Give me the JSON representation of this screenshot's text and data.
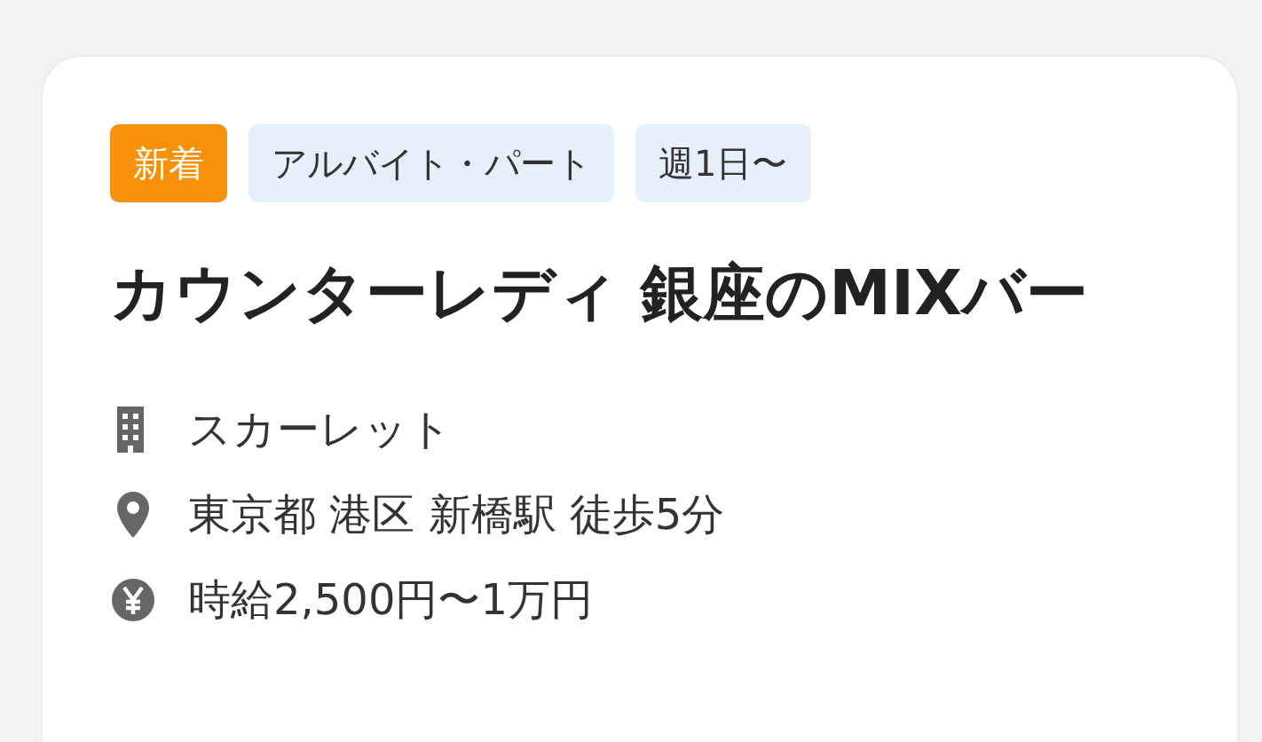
{
  "tags": [
    {
      "label": "新着",
      "kind": "new"
    },
    {
      "label": "アルバイト・パート",
      "kind": "normal"
    },
    {
      "label": "週1日〜",
      "kind": "normal"
    }
  ],
  "title": "カウンターレディ 銀座のMIXバー",
  "details": [
    {
      "kind": "company",
      "text": "スカーレット"
    },
    {
      "kind": "location",
      "text": "東京都 港区 新橋駅 徒歩5分"
    },
    {
      "kind": "salary",
      "text": "時給2,500円〜1万円"
    }
  ]
}
